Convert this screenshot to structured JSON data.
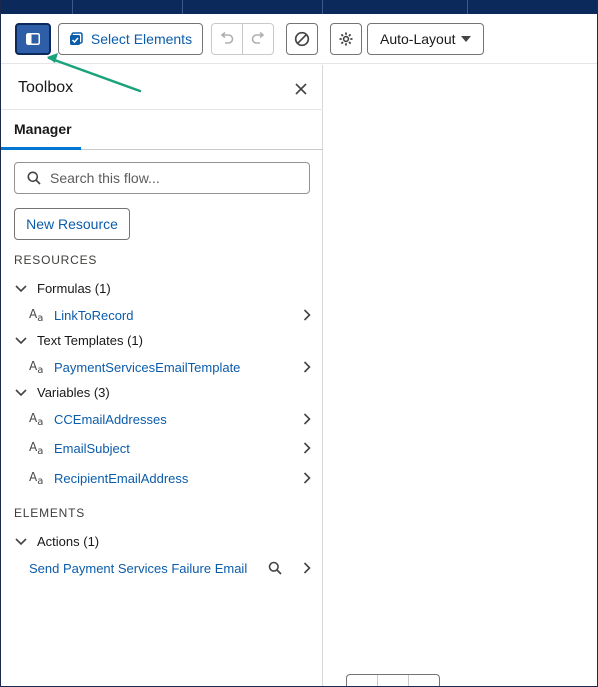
{
  "toolbar": {
    "select_elements_label": "Select Elements",
    "layout_label": "Auto-Layout",
    "toggle_icon": "panel-toggle-icon",
    "undo_icon": "undo-icon",
    "redo_icon": "redo-icon",
    "block_icon": "prohibit-icon",
    "gear_icon": "gear-icon"
  },
  "toolbox": {
    "title": "Toolbox",
    "tab": "Manager",
    "search_placeholder": "Search this flow...",
    "new_resource_label": "New Resource",
    "resources_heading": "RESOURCES",
    "elements_heading": "ELEMENTS",
    "groups": {
      "formulas": "Formulas (1)",
      "text_templates": "Text Templates (1)",
      "variables": "Variables (3)",
      "actions": "Actions (1)"
    },
    "formulas": [
      "LinkToRecord"
    ],
    "text_templates": [
      "PaymentServicesEmailTemplate"
    ],
    "variables": [
      "CCEmailAddresses",
      "EmailSubject",
      "RecipientEmailAddress"
    ],
    "actions": [
      "Send Payment Services Failure Email"
    ]
  },
  "colors": {
    "brand": "#0b5cab",
    "top_strip": "#0b2a5b",
    "active_tab": "#0176d3",
    "annotation_arrow": "#1aa37a"
  }
}
